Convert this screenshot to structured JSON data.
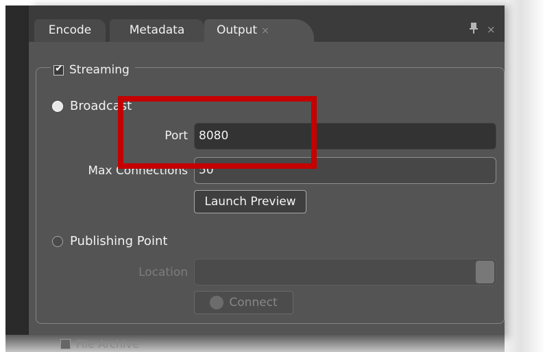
{
  "tabs": {
    "encode": "Encode",
    "metadata": "Metadata",
    "output": "Output",
    "output_close": "×",
    "panel_close": "×"
  },
  "streaming": {
    "label": "Streaming",
    "checked": true
  },
  "broadcast": {
    "label": "Broadcast",
    "port_label": "Port",
    "port_value": "8080",
    "max_connections_label": "Max Connections",
    "max_connections_value": "50",
    "launch_preview": "Launch Preview"
  },
  "publishing_point": {
    "label": "Publishing Point",
    "location_label": "Location",
    "location_value": "",
    "connect": "Connect"
  },
  "file_archive": {
    "label": "File Archive"
  },
  "icons": {
    "pin": "pin-icon",
    "close": "close-icon"
  },
  "colors": {
    "highlight": "#c40000",
    "panel_bg": "#545454",
    "tabbar_bg": "#3b3b3b"
  }
}
